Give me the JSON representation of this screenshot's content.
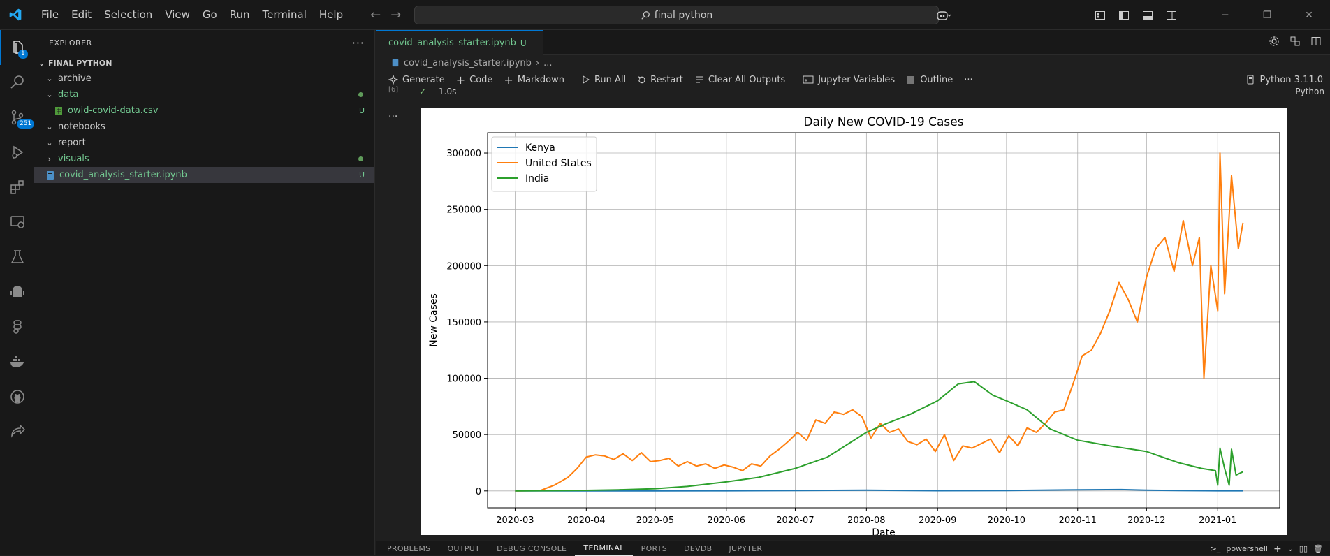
{
  "menu": [
    "File",
    "Edit",
    "Selection",
    "View",
    "Go",
    "Run",
    "Terminal",
    "Help"
  ],
  "command_center": "final python",
  "activity_badges": {
    "explorer": "1",
    "source_control": "251"
  },
  "sidebar": {
    "title": "EXPLORER",
    "section": "FINAL PYTHON",
    "items": [
      {
        "label": "archive",
        "chevron": "⌄",
        "color": "#cccccc",
        "status": ""
      },
      {
        "label": "data",
        "chevron": "⌄",
        "color": "#73c991",
        "status": ""
      },
      {
        "label": "owid-covid-data.csv",
        "chevron": "",
        "color": "#73c991",
        "status": "U"
      },
      {
        "label": "notebooks",
        "chevron": "⌄",
        "color": "#cccccc",
        "status": ""
      },
      {
        "label": "report",
        "chevron": "⌄",
        "color": "#cccccc",
        "status": ""
      },
      {
        "label": "visuals",
        "chevron": "›",
        "color": "#73c991",
        "status": ""
      },
      {
        "label": "covid_analysis_starter.ipynb",
        "chevron": "",
        "color": "#73c991",
        "status": "U"
      }
    ]
  },
  "editor": {
    "tab_label": "covid_analysis_starter.ipynb",
    "tab_status": "U",
    "breadcrumb_file": "covid_analysis_starter.ipynb",
    "breadcrumb_more": "...",
    "toolbar": {
      "generate": "Generate",
      "code": "Code",
      "markdown": "Markdown",
      "run_all": "Run All",
      "restart": "Restart",
      "clear_outputs": "Clear All Outputs",
      "variables": "Jupyter Variables",
      "outline": "Outline",
      "more": "···"
    },
    "kernel": "Python 3.11.0",
    "cell_index": "[6]",
    "cell_time": "1.0s",
    "cell_lang": "Python"
  },
  "panel": {
    "tabs": [
      "PROBLEMS",
      "OUTPUT",
      "DEBUG CONSOLE",
      "TERMINAL",
      "PORTS",
      "DEVDB",
      "JUPYTER"
    ],
    "active": "TERMINAL",
    "terminal_name": "powershell"
  },
  "chart_data": {
    "type": "line",
    "title": "Daily New COVID-19 Cases",
    "xlabel": "Date",
    "ylabel": "New Cases",
    "ylim": [
      -15000,
      318000
    ],
    "xlim": [
      "2020-02-18",
      "2021-01-28"
    ],
    "yticks": [
      0,
      50000,
      100000,
      150000,
      200000,
      250000,
      300000
    ],
    "xticks": [
      "2020-03",
      "2020-04",
      "2020-05",
      "2020-06",
      "2020-07",
      "2020-08",
      "2020-09",
      "2020-10",
      "2020-11",
      "2020-12",
      "2021-01"
    ],
    "grid": true,
    "legend": "top-left",
    "series": [
      {
        "name": "Kenya",
        "color": "#1f77b4",
        "points": [
          [
            "2020-03-01",
            0
          ],
          [
            "2020-04-01",
            20
          ],
          [
            "2020-05-01",
            50
          ],
          [
            "2020-06-01",
            150
          ],
          [
            "2020-07-01",
            300
          ],
          [
            "2020-08-01",
            600
          ],
          [
            "2020-09-01",
            200
          ],
          [
            "2020-10-01",
            300
          ],
          [
            "2020-11-01",
            1000
          ],
          [
            "2020-11-20",
            1200
          ],
          [
            "2020-12-01",
            700
          ],
          [
            "2020-12-15",
            300
          ],
          [
            "2021-01-01",
            150
          ],
          [
            "2021-01-12",
            100
          ]
        ]
      },
      {
        "name": "United States",
        "color": "#ff7f0e",
        "points": [
          [
            "2020-03-01",
            0
          ],
          [
            "2020-03-12",
            400
          ],
          [
            "2020-03-18",
            5000
          ],
          [
            "2020-03-24",
            12000
          ],
          [
            "2020-03-28",
            20000
          ],
          [
            "2020-04-01",
            30000
          ],
          [
            "2020-04-05",
            32000
          ],
          [
            "2020-04-09",
            31000
          ],
          [
            "2020-04-13",
            28000
          ],
          [
            "2020-04-17",
            33000
          ],
          [
            "2020-04-21",
            27000
          ],
          [
            "2020-04-25",
            34000
          ],
          [
            "2020-04-29",
            26000
          ],
          [
            "2020-05-03",
            27000
          ],
          [
            "2020-05-07",
            29000
          ],
          [
            "2020-05-11",
            22000
          ],
          [
            "2020-05-15",
            26000
          ],
          [
            "2020-05-19",
            22000
          ],
          [
            "2020-05-23",
            24000
          ],
          [
            "2020-05-27",
            20000
          ],
          [
            "2020-05-31",
            23000
          ],
          [
            "2020-06-04",
            21000
          ],
          [
            "2020-06-08",
            18000
          ],
          [
            "2020-06-12",
            24000
          ],
          [
            "2020-06-16",
            22000
          ],
          [
            "2020-06-20",
            31000
          ],
          [
            "2020-06-24",
            37000
          ],
          [
            "2020-06-28",
            44000
          ],
          [
            "2020-07-02",
            52000
          ],
          [
            "2020-07-06",
            45000
          ],
          [
            "2020-07-10",
            63000
          ],
          [
            "2020-07-14",
            60000
          ],
          [
            "2020-07-18",
            70000
          ],
          [
            "2020-07-22",
            68000
          ],
          [
            "2020-07-26",
            72000
          ],
          [
            "2020-07-30",
            66000
          ],
          [
            "2020-08-03",
            47000
          ],
          [
            "2020-08-07",
            60000
          ],
          [
            "2020-08-11",
            52000
          ],
          [
            "2020-08-15",
            55000
          ],
          [
            "2020-08-19",
            44000
          ],
          [
            "2020-08-23",
            41000
          ],
          [
            "2020-08-27",
            46000
          ],
          [
            "2020-08-31",
            35000
          ],
          [
            "2020-09-04",
            50000
          ],
          [
            "2020-09-08",
            27000
          ],
          [
            "2020-09-12",
            40000
          ],
          [
            "2020-09-16",
            38000
          ],
          [
            "2020-09-20",
            42000
          ],
          [
            "2020-09-24",
            46000
          ],
          [
            "2020-09-28",
            34000
          ],
          [
            "2020-10-02",
            49000
          ],
          [
            "2020-10-06",
            40000
          ],
          [
            "2020-10-10",
            56000
          ],
          [
            "2020-10-14",
            52000
          ],
          [
            "2020-10-18",
            60000
          ],
          [
            "2020-10-22",
            70000
          ],
          [
            "2020-10-26",
            72000
          ],
          [
            "2020-10-30",
            95000
          ],
          [
            "2020-11-03",
            120000
          ],
          [
            "2020-11-07",
            125000
          ],
          [
            "2020-11-11",
            140000
          ],
          [
            "2020-11-15",
            160000
          ],
          [
            "2020-11-19",
            185000
          ],
          [
            "2020-11-23",
            170000
          ],
          [
            "2020-11-27",
            150000
          ],
          [
            "2020-12-01",
            190000
          ],
          [
            "2020-12-05",
            215000
          ],
          [
            "2020-12-09",
            225000
          ],
          [
            "2020-12-13",
            195000
          ],
          [
            "2020-12-17",
            240000
          ],
          [
            "2020-12-21",
            200000
          ],
          [
            "2020-12-24",
            225000
          ],
          [
            "2020-12-26",
            100000
          ],
          [
            "2020-12-29",
            200000
          ],
          [
            "2021-01-01",
            160000
          ],
          [
            "2021-01-02",
            300000
          ],
          [
            "2021-01-04",
            175000
          ],
          [
            "2021-01-07",
            280000
          ],
          [
            "2021-01-10",
            215000
          ],
          [
            "2021-01-12",
            238000
          ]
        ]
      },
      {
        "name": "India",
        "color": "#2ca02c",
        "points": [
          [
            "2020-03-01",
            0
          ],
          [
            "2020-04-01",
            500
          ],
          [
            "2020-04-15",
            1000
          ],
          [
            "2020-05-01",
            2000
          ],
          [
            "2020-05-15",
            4000
          ],
          [
            "2020-06-01",
            8000
          ],
          [
            "2020-06-15",
            12000
          ],
          [
            "2020-07-01",
            20000
          ],
          [
            "2020-07-15",
            30000
          ],
          [
            "2020-08-01",
            52000
          ],
          [
            "2020-08-10",
            60000
          ],
          [
            "2020-08-20",
            68000
          ],
          [
            "2020-09-01",
            80000
          ],
          [
            "2020-09-10",
            95000
          ],
          [
            "2020-09-17",
            97000
          ],
          [
            "2020-09-25",
            85000
          ],
          [
            "2020-10-01",
            80000
          ],
          [
            "2020-10-10",
            72000
          ],
          [
            "2020-10-20",
            55000
          ],
          [
            "2020-11-01",
            45000
          ],
          [
            "2020-11-15",
            40000
          ],
          [
            "2020-12-01",
            35000
          ],
          [
            "2020-12-15",
            25000
          ],
          [
            "2020-12-25",
            20000
          ],
          [
            "2020-12-31",
            18000
          ],
          [
            "2021-01-01",
            5000
          ],
          [
            "2021-01-02",
            38000
          ],
          [
            "2021-01-04",
            20000
          ],
          [
            "2021-01-06",
            5000
          ],
          [
            "2021-01-07",
            37000
          ],
          [
            "2021-01-09",
            14000
          ],
          [
            "2021-01-12",
            17000
          ]
        ]
      }
    ]
  }
}
